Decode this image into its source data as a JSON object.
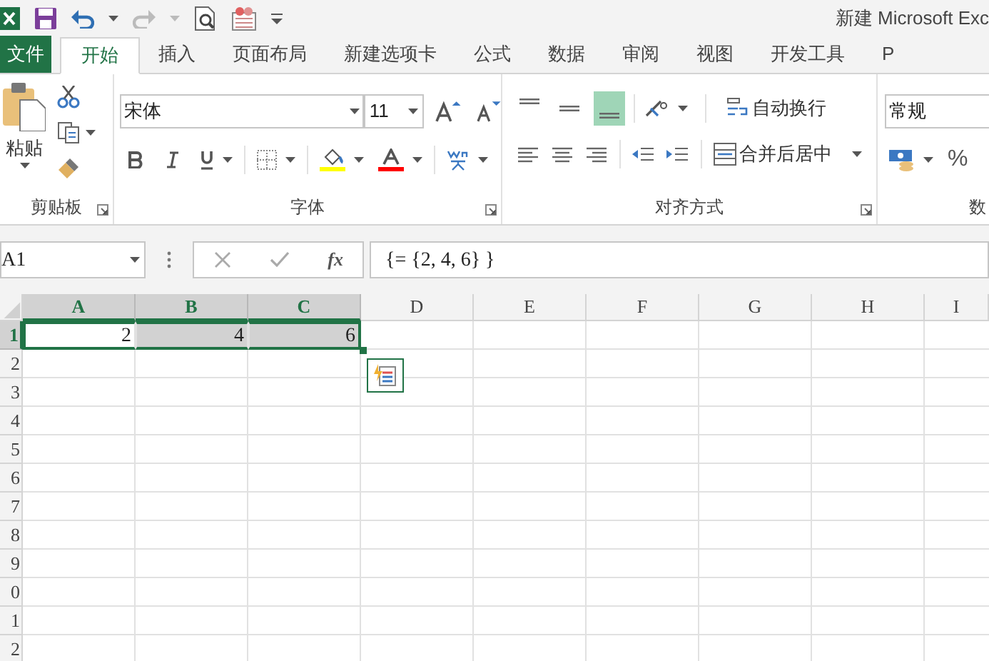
{
  "title_bar": {
    "title": "新建 Microsoft Exc"
  },
  "tabs": [
    {
      "label": "文件",
      "kind": "file",
      "selected": false
    },
    {
      "label": "开始",
      "kind": "tab",
      "selected": true
    },
    {
      "label": "插入",
      "kind": "tab",
      "selected": false
    },
    {
      "label": "页面布局",
      "kind": "tab",
      "selected": false
    },
    {
      "label": "新建选项卡",
      "kind": "tab",
      "selected": false
    },
    {
      "label": "公式",
      "kind": "tab",
      "selected": false
    },
    {
      "label": "数据",
      "kind": "tab",
      "selected": false
    },
    {
      "label": "审阅",
      "kind": "tab",
      "selected": false
    },
    {
      "label": "视图",
      "kind": "tab",
      "selected": false
    },
    {
      "label": "开发工具",
      "kind": "tab",
      "selected": false
    },
    {
      "label": "P",
      "kind": "tab",
      "selected": false
    }
  ],
  "ribbon": {
    "paste_label": "粘贴",
    "font_name": "宋体",
    "font_size": "11",
    "wrap_text": "自动换行",
    "merge_center": "合并后居中",
    "number_format": "常规",
    "percent": "%",
    "vertical_align": [
      {
        "kind": "top",
        "selected": false
      },
      {
        "kind": "middle",
        "selected": false
      },
      {
        "kind": "bottom",
        "selected": true
      }
    ],
    "groups": [
      {
        "label": "剪贴板"
      },
      {
        "label": "字体"
      },
      {
        "label": "对齐方式"
      },
      {
        "label": "数"
      }
    ]
  },
  "formula_bar": {
    "name_box": "A1",
    "function_label": "fx",
    "formula": "{= {2, 4, 6} }"
  },
  "sheet": {
    "columns": [
      {
        "label": "A",
        "selected": true
      },
      {
        "label": "B",
        "selected": true
      },
      {
        "label": "C",
        "selected": true
      },
      {
        "label": "D",
        "selected": false
      },
      {
        "label": "E",
        "selected": false
      },
      {
        "label": "F",
        "selected": false
      },
      {
        "label": "G",
        "selected": false
      },
      {
        "label": "H",
        "selected": false
      },
      {
        "label": "I",
        "selected": false
      }
    ],
    "rows": [
      {
        "label": "1",
        "selected": true,
        "cells": [
          {
            "value": "2",
            "selected": true,
            "active": true
          },
          {
            "value": "4",
            "selected": true,
            "active": false
          },
          {
            "value": "6",
            "selected": true,
            "active": false
          }
        ]
      },
      {
        "label": "2",
        "selected": false
      },
      {
        "label": "3",
        "selected": false
      },
      {
        "label": "4",
        "selected": false
      },
      {
        "label": "5",
        "selected": false
      },
      {
        "label": "6",
        "selected": false
      },
      {
        "label": "7",
        "selected": false
      },
      {
        "label": "8",
        "selected": false
      },
      {
        "label": "9",
        "selected": false
      },
      {
        "label": "0",
        "selected": false
      },
      {
        "label": "1",
        "selected": false
      },
      {
        "label": "2",
        "selected": false
      }
    ]
  }
}
